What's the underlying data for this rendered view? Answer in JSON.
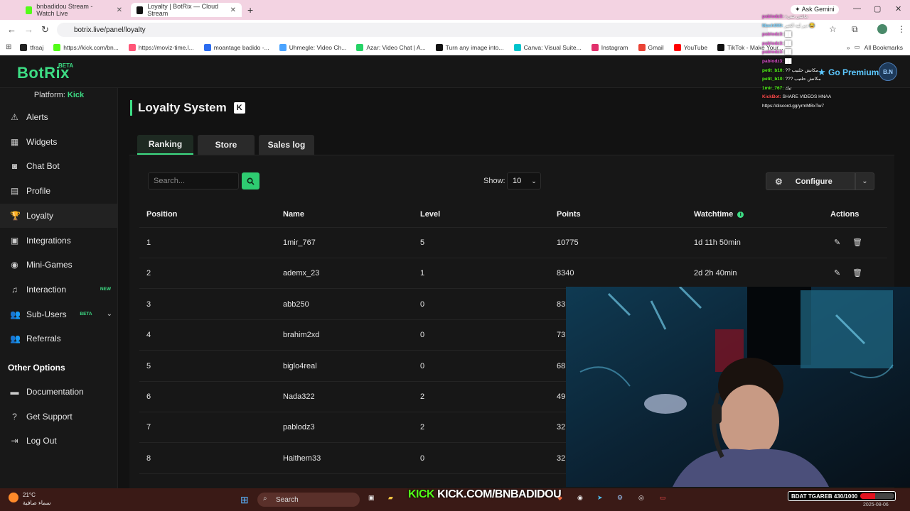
{
  "browser": {
    "tabs": [
      {
        "title": "bnbadidou Stream - Watch Live",
        "icon_color": "#53fc18"
      },
      {
        "title": "Loyalty | BotRix — Cloud Stream",
        "icon_color": "#111111"
      }
    ],
    "new_tab": "+",
    "url": "botrix.live/panel/loyalty",
    "ask_gemini": "Ask Gemini",
    "bookmarks": [
      {
        "label": "tfraaj",
        "color": "#222222"
      },
      {
        "label": "https://kick.com/bn...",
        "color": "#53fc18"
      },
      {
        "label": "https://moviz-time.l...",
        "color": "#ff5577"
      },
      {
        "label": "moantage badido -...",
        "color": "#2b6cf0"
      },
      {
        "label": "Uhmegle: Video Ch...",
        "color": "#4aa3ff"
      },
      {
        "label": "Azar: Video Chat | A...",
        "color": "#25d366"
      },
      {
        "label": "Turn any image into...",
        "color": "#111111"
      },
      {
        "label": "Canva: Visual Suite...",
        "color": "#00c4cc"
      },
      {
        "label": "Instagram",
        "color": "#e1306c"
      },
      {
        "label": "Gmail",
        "color": "#ea4335"
      },
      {
        "label": "YouTube",
        "color": "#ff0000"
      },
      {
        "label": "TikTok - Make Your...",
        "color": "#111111"
      }
    ],
    "all_bookmarks": "All Bookmarks"
  },
  "app": {
    "logo": "BotRix",
    "beta": "BETA",
    "premium": "Go Premium",
    "avatar": "B.N",
    "platform_label": "Platform:",
    "platform_value": "Kick",
    "nav": [
      {
        "label": "Alerts",
        "icon": "warning-icon",
        "glyph": "⚠"
      },
      {
        "label": "Widgets",
        "icon": "widgets-icon",
        "glyph": "▦"
      },
      {
        "label": "Chat Bot",
        "icon": "robot-icon",
        "glyph": "◙"
      },
      {
        "label": "Profile",
        "icon": "profile-icon",
        "glyph": "▤"
      },
      {
        "label": "Loyalty",
        "icon": "trophy-icon",
        "glyph": "🏆",
        "active": true
      },
      {
        "label": "Integrations",
        "icon": "integrations-icon",
        "glyph": "▣"
      },
      {
        "label": "Mini-Games",
        "icon": "gamepad-icon",
        "glyph": "◉"
      },
      {
        "label": "Interaction",
        "icon": "music-icon",
        "glyph": "♫",
        "badge": "NEW"
      },
      {
        "label": "Sub-Users",
        "icon": "users-icon",
        "glyph": "👥",
        "badge": "BETA",
        "chevron": "⌄"
      },
      {
        "label": "Referrals",
        "icon": "referrals-icon",
        "glyph": "👥"
      }
    ],
    "other_options_title": "Other Options",
    "other_nav": [
      {
        "label": "Documentation",
        "icon": "book-icon",
        "glyph": "▬"
      },
      {
        "label": "Get Support",
        "icon": "help-icon",
        "glyph": "?"
      },
      {
        "label": "Log Out",
        "icon": "logout-icon",
        "glyph": "⇥"
      }
    ]
  },
  "page": {
    "title": "Loyalty System",
    "kick_icon": "K",
    "tabs": [
      "Ranking",
      "Store",
      "Sales log"
    ],
    "search_placeholder": "Search...",
    "show_label": "Show:",
    "show_value": "10",
    "configure": "Configure",
    "columns": [
      "Position",
      "Name",
      "Level",
      "Points",
      "Watchtime",
      "Actions"
    ],
    "rows": [
      {
        "position": "1",
        "name": "1mir_767",
        "level": "5",
        "points": "10775",
        "watchtime": "1d 11h 50min"
      },
      {
        "position": "2",
        "name": "ademx_23",
        "level": "1",
        "points": "8340",
        "watchtime": "2d 2h 40min"
      },
      {
        "position": "3",
        "name": "abb250",
        "level": "0",
        "points": "83",
        "watchtime": ""
      },
      {
        "position": "4",
        "name": "brahim2xd",
        "level": "0",
        "points": "73",
        "watchtime": ""
      },
      {
        "position": "5",
        "name": "biglo4real",
        "level": "0",
        "points": "68",
        "watchtime": ""
      },
      {
        "position": "6",
        "name": "Nada322",
        "level": "2",
        "points": "49",
        "watchtime": ""
      },
      {
        "position": "7",
        "name": "pablodz3",
        "level": "2",
        "points": "32",
        "watchtime": ""
      },
      {
        "position": "8",
        "name": "Haithem33",
        "level": "0",
        "points": "32",
        "watchtime": ""
      }
    ]
  },
  "chat": [
    {
      "user": "pablodz3:",
      "color": "#e04fd0",
      "msg": "ماشي شيء"
    },
    {
      "user": "Mach999:",
      "color": "#7fd4ff",
      "msg": "دير ليه الخير 😂"
    },
    {
      "user": "pablodz3:",
      "color": "#e04fd0",
      "msg": "██"
    },
    {
      "user": "pablodz3:",
      "color": "#e04fd0",
      "msg": "██"
    },
    {
      "user": "pablodz3:",
      "color": "#e04fd0",
      "msg": "██"
    },
    {
      "user": "pablodz3:",
      "color": "#e04fd0",
      "msg": "██"
    },
    {
      "user": "petit_b10:",
      "color": "#53fc18",
      "msg": "?? مكانش حلتيب"
    },
    {
      "user": "petit_b10:",
      "color": "#53fc18",
      "msg": "??? مكانش حلتيب"
    },
    {
      "user": "1mir_767:",
      "color": "#53fc18",
      "msg": "تيك"
    },
    {
      "user": "KickBot:",
      "color": "#ff4d4d",
      "msg": "SHARE VIDEOS HNAA"
    },
    {
      "user": "",
      "color": "#ffffff",
      "msg": "https://discord.gg/yrmMBxTw7"
    }
  ],
  "overlay": {
    "stream_link_prefix": "KICK",
    "stream_link": "KICK.COM/BNBADIDOU",
    "goal_label": "BDAT TGAREB 430/1000",
    "goal_progress": 0.43
  },
  "taskbar": {
    "temp": "21°C",
    "weather": "سماء صافية",
    "search": "Search",
    "date": "2025-08-06"
  }
}
